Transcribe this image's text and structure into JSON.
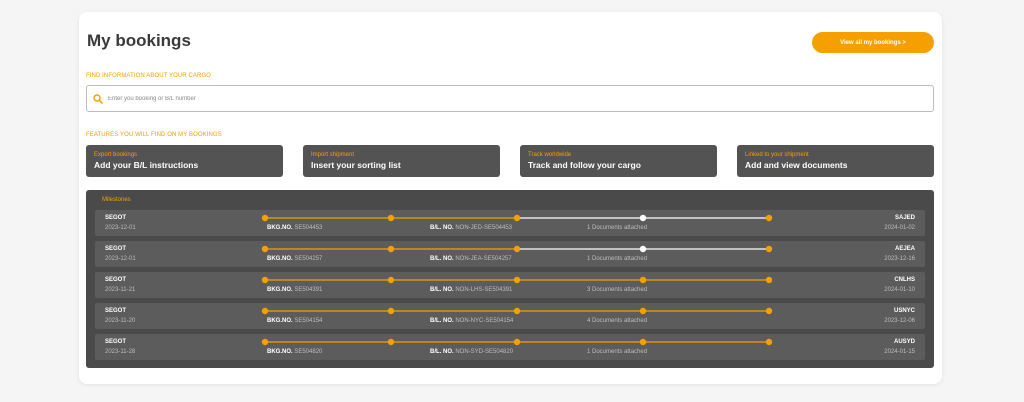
{
  "page": {
    "title": "My bookings"
  },
  "header": {
    "view_all_label": "View all my bookings >"
  },
  "search": {
    "section_label": "FIND INFORMATION ABOUT YOUR CARGO",
    "placeholder": "Enter you booking or B/L number",
    "value": ""
  },
  "features": {
    "section_label": "FEATURES YOU WILL FIND ON MY BOOKINGS",
    "items": [
      {
        "subtitle": "Export bookings",
        "title": "Add your B/L instructions"
      },
      {
        "subtitle": "Import shipment",
        "title": "Insert your sorting list"
      },
      {
        "subtitle": "Track worldwide",
        "title": "Track and follow your cargo"
      },
      {
        "subtitle": "Linked to your shipment",
        "title": "Add and view documents"
      }
    ]
  },
  "milestones": {
    "title": "Milestones",
    "bkg_label": "BKG.NO.",
    "bl_label": "B/L. NO.",
    "rows": [
      {
        "origin": "SEGOT",
        "origin_date": "2023-12-01",
        "bkg_no": "SE504453",
        "bl_no": "NON-JED-SE504453",
        "docs": "1 Documents attached",
        "destination": "SAJED",
        "destination_date": "2024-01-02",
        "milestones_completed": 3,
        "milestones_total": 5
      },
      {
        "origin": "SEGOT",
        "origin_date": "2023-12-01",
        "bkg_no": "SE504257",
        "bl_no": "NON-JEA-SE504257",
        "docs": "1 Documents attached",
        "destination": "AEJEA",
        "destination_date": "2023-12-16",
        "milestones_completed": 3,
        "milestones_total": 5
      },
      {
        "origin": "SEGOT",
        "origin_date": "2023-11-21",
        "bkg_no": "SE504391",
        "bl_no": "NON-LHS-SE504391",
        "docs": "3 Documents attached",
        "destination": "CNLHS",
        "destination_date": "2024-01-10",
        "milestones_completed": 5,
        "milestones_total": 5
      },
      {
        "origin": "SEGOT",
        "origin_date": "2023-11-20",
        "bkg_no": "SE504154",
        "bl_no": "NON-NYC-SE504154",
        "docs": "4 Documents attached",
        "destination": "USNYC",
        "destination_date": "2023-12-06",
        "milestones_completed": 5,
        "milestones_total": 5
      },
      {
        "origin": "SEGOT",
        "origin_date": "2023-11-28",
        "bkg_no": "SE504820",
        "bl_no": "NON-SYD-SE504820",
        "docs": "1 Documents attached",
        "destination": "AUSYD",
        "destination_date": "2024-01-15",
        "milestones_completed": 5,
        "milestones_total": 5
      }
    ]
  },
  "colors": {
    "accent": "#f5a000",
    "panel": "#4a4a4a",
    "row": "#5c5c5c",
    "pending": "#ffffff"
  }
}
